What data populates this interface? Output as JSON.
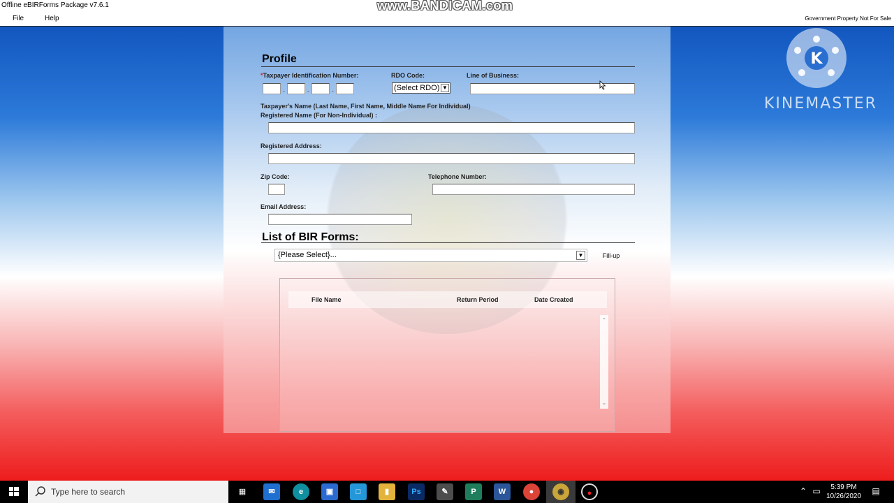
{
  "window": {
    "title": "Offline eBIRForms Package v7.6.1",
    "recorder_watermark": "www.BANDICAM.com"
  },
  "menu": {
    "file": "File",
    "help": "Help",
    "notice": "Government Property Not For Sale"
  },
  "kinemaster": {
    "text": "KINEMASTER"
  },
  "profile": {
    "title": "Profile",
    "tin_label": "Taxpayer Identification Number:",
    "required_mark": "*",
    "tin_sep": "-",
    "rdo_label": "RDO Code:",
    "rdo_value": "(Select RDO)",
    "lob_label": "Line of Business:",
    "name_label_1": "Taxpayer's Name (Last Name, First Name, Middle Name For Individual)",
    "name_label_2": "Registered Name (For Non-Individual) :",
    "address_label": "Registered Address:",
    "zip_label": "Zip Code:",
    "phone_label": "Telephone Number:",
    "email_label": "Email Address:"
  },
  "forms": {
    "title": "List of BIR Forms:",
    "select_value": "{Please Select}...",
    "fillup_label": "Fill-up",
    "columns": [
      "File Name",
      "Return Period",
      "Date Created"
    ]
  },
  "taskbar": {
    "search_placeholder": "Type here to search",
    "time": "5:39 PM",
    "date": "10/26/2020"
  },
  "colors": {
    "bg_top": "#1257bf",
    "bg_bottom": "#ee1c1c",
    "required": "#d22222"
  }
}
